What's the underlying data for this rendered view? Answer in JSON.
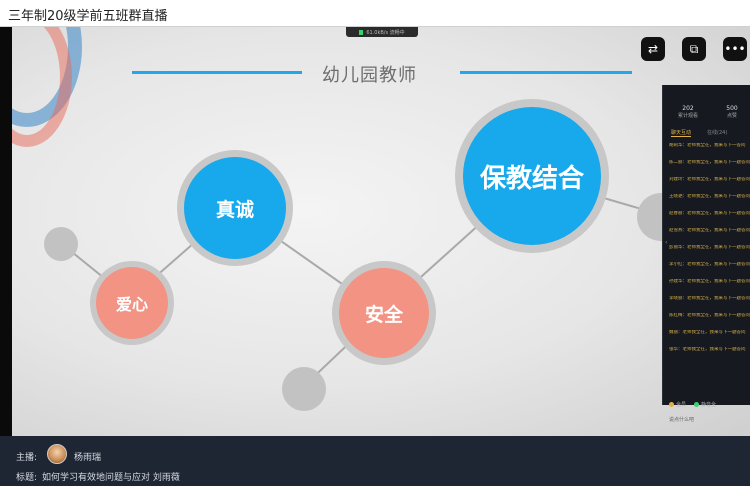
{
  "window": {
    "title": "三年制20级学前五班群直播"
  },
  "slide": {
    "heading": "幼儿园教师",
    "nodes": {
      "big": "保教结合",
      "zhencheng": "真诚",
      "aixin": "爱心",
      "anquan": "安全"
    },
    "colors": {
      "blue": "#18a8ec",
      "salmon": "#f39384",
      "gray": "#c2c2c2"
    }
  },
  "toolbar": {
    "pill_text": "61.0kB/s 流畅中",
    "buttons": [
      {
        "icon": "screen-switch-icon"
      },
      {
        "icon": "popout-window-icon"
      },
      {
        "icon": "more-icon"
      }
    ]
  },
  "panel": {
    "stats": [
      {
        "value": "202",
        "label": "累计观看"
      },
      {
        "value": "500",
        "label": "点赞"
      }
    ],
    "tabs": [
      "聊天互动",
      "在线(24)"
    ],
    "messages": [
      "胡莉华：老师我全在，我来写下一答问",
      "陈二丽：老师我全在，我来写下一题答问",
      "刘建玲：老师我全在，我来写下一题答问",
      "王晓艳：老师我全在，我来写下一题答问",
      "赵春丽：老师我全在，我来写下一题答问",
      "赵雪燕：老师我全在，我来写下一题答问",
      "彭丽华：老师我全在，我来写下一题答问",
      "李小红：老师我全在，我来写下一题答问",
      "孙建华：老师我全在，我来写下一题答问",
      "李晓丽：老师我全在，我来写下一题答问",
      "陈红梅：老师我全在，我来写下一题答问",
      "魏丽：老师我全在，我来写下一题答问",
      "张华：老师我全在，我来写下一题答问"
    ],
    "bottom_left": "全员",
    "bottom_right": "静音全",
    "input_placeholder": "说点什么吧"
  },
  "info": {
    "host_label": "主播:",
    "host_name": "杨雨瑞",
    "subject_label": "标题:",
    "subject": "如何学习有效地问题与应对 刘雨薇"
  }
}
